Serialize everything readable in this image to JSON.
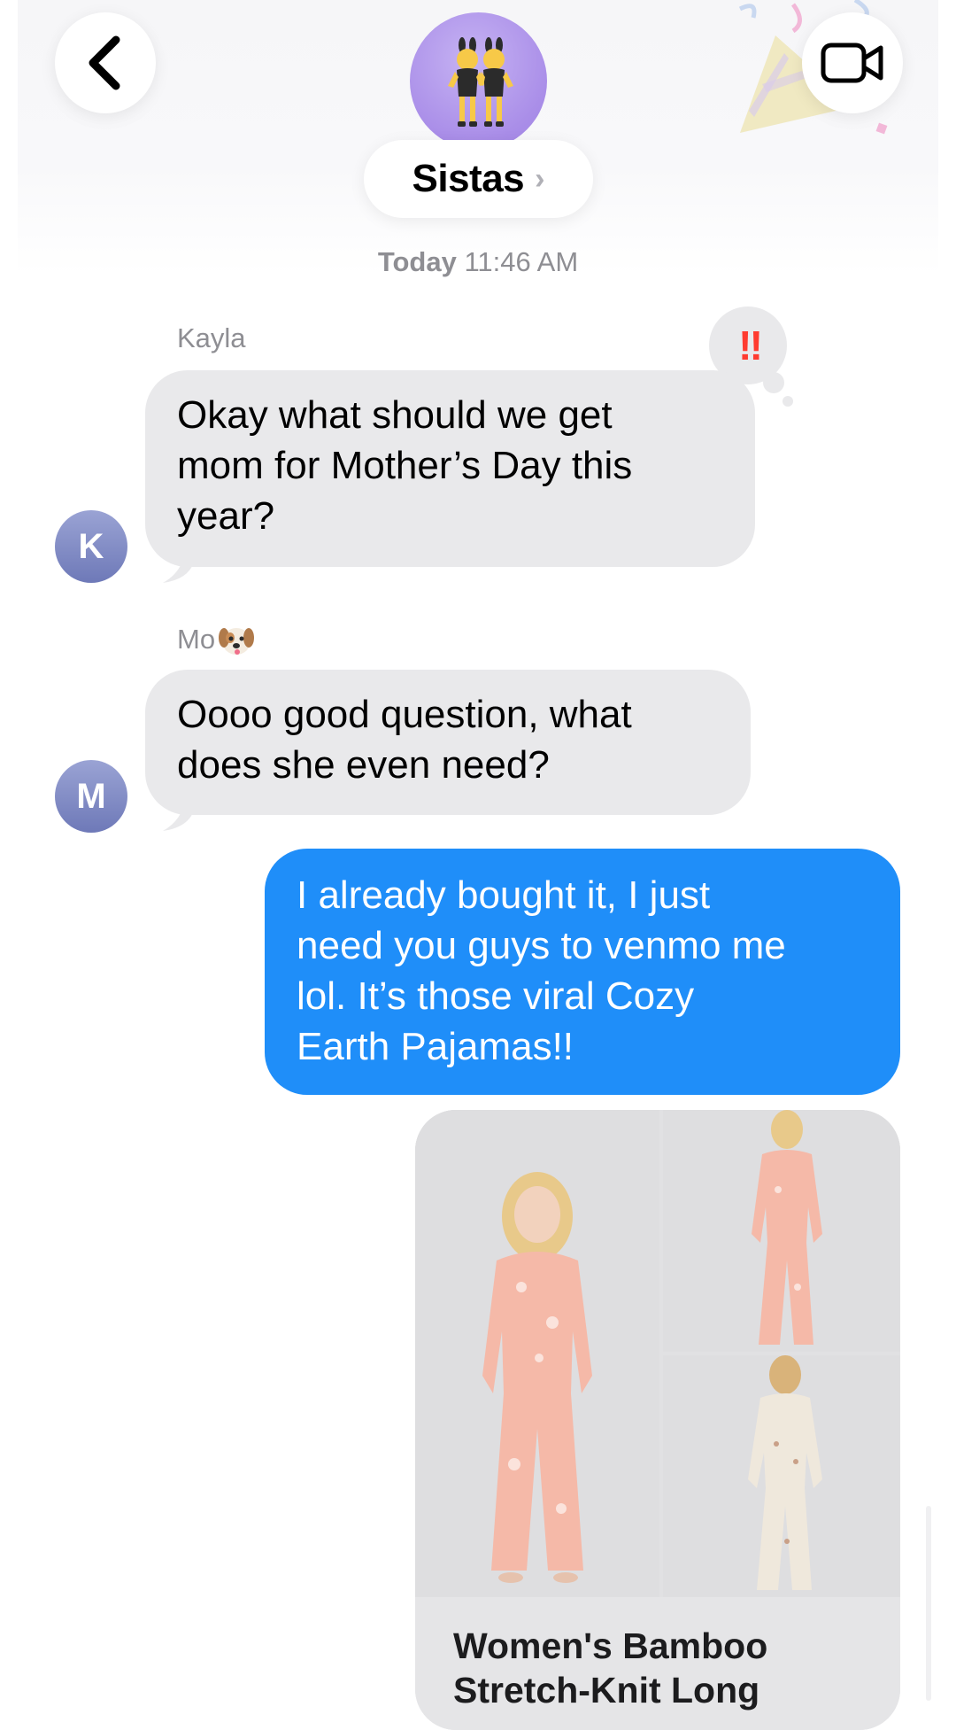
{
  "header": {
    "group_name": "Sistas",
    "group_avatar_icon": "dancing-women-emoji",
    "back_icon": "chevron-left-icon",
    "video_icon": "video-camera-icon",
    "effect_icon": "party-popper-icon"
  },
  "timestamp": {
    "day": "Today",
    "time": "11:46 AM"
  },
  "messages": [
    {
      "sender": "Kayla",
      "initial": "K",
      "text_lines": [
        "Okay what should we get",
        "mom for Mother’s Day this",
        "year?"
      ],
      "tapback": "‼"
    },
    {
      "sender": "Mo",
      "sender_emoji": "dog-face-emoji",
      "initial": "M",
      "text_lines": [
        "Oooo good question, what",
        "does she even need?"
      ]
    },
    {
      "sender": "me",
      "text_lines": [
        "I already bought it, I just",
        "need you guys to venmo me",
        "lol. It’s those viral Cozy",
        "Earth Pajamas!!"
      ]
    }
  ],
  "link_preview": {
    "title_lines": [
      "Women's Bamboo",
      "Stretch-Knit Long"
    ],
    "images": [
      "pink-floral-pajamas-full",
      "pink-floral-pajamas-model",
      "cream-pajamas-model"
    ]
  },
  "colors": {
    "incoming_bubble": "#e9e9eb",
    "outgoing_bubble": "#1f8ef9",
    "avatar_gradient": "#7f89c5",
    "group_avatar": "#a98de8",
    "tapback_exclaim": "#ff3b30"
  }
}
